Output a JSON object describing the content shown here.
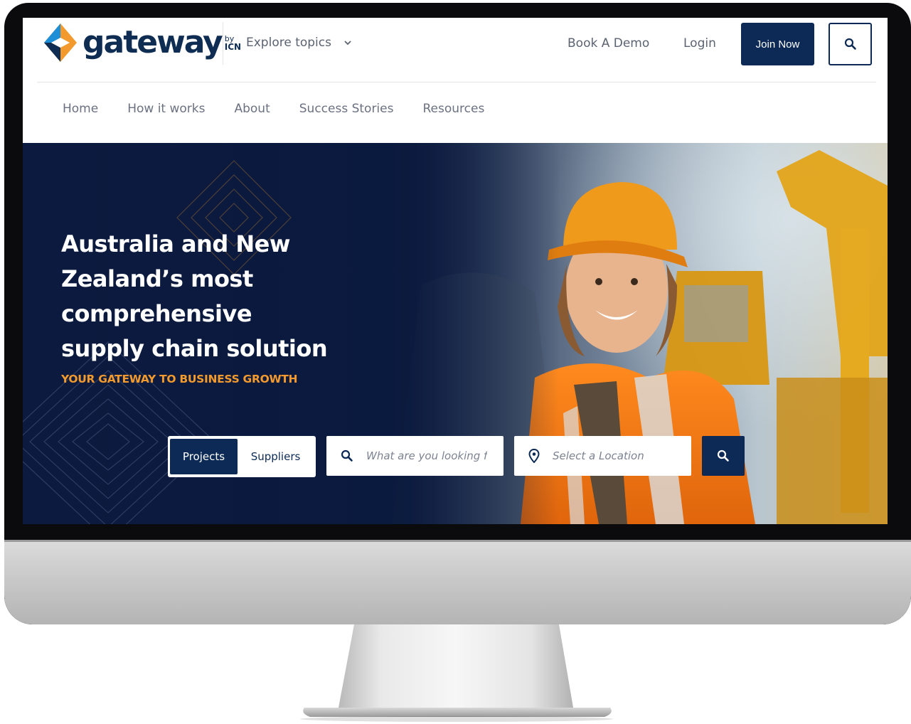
{
  "brand": {
    "name": "gateway",
    "by": "by",
    "org": "ICN",
    "colors": {
      "navy": "#0c2a55",
      "orange": "#f29a2e",
      "blue": "#1d8fd8"
    }
  },
  "header": {
    "explore_label": "Explore topics",
    "book_demo": "Book A Demo",
    "login": "Login",
    "join": "Join Now"
  },
  "nav": {
    "items": [
      "Home",
      "How it works",
      "About",
      "Success Stories",
      "Resources"
    ]
  },
  "hero": {
    "title": "Australia and New Zealand’s most comprehensive supply chain solution",
    "subtitle": "YOUR GATEWAY TO BUSINESS GROWTH",
    "toggle": {
      "active": "Projects",
      "inactive": "Suppliers"
    },
    "search_placeholder": "What are you looking for?",
    "location_placeholder": "Select a Location"
  },
  "icons": {
    "search": "search-icon",
    "chevron": "chevron-down-icon",
    "location": "location-pin-icon"
  }
}
